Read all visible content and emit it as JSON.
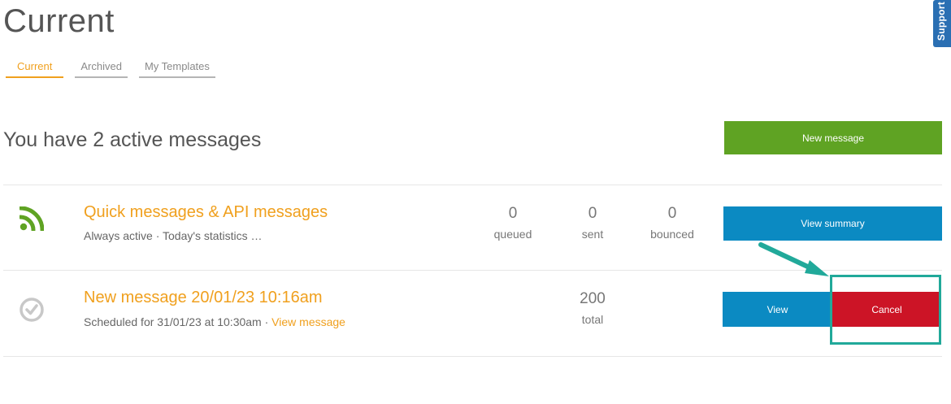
{
  "page": {
    "title": "Current",
    "support_label": "Support"
  },
  "tabs": [
    {
      "label": "Current",
      "active": true
    },
    {
      "label": "Archived",
      "active": false
    },
    {
      "label": "My Templates",
      "active": false
    }
  ],
  "summary": {
    "heading": "You have 2 active messages",
    "new_message_label": "New message"
  },
  "messages": [
    {
      "icon": "rss-feed-icon",
      "title": "Quick messages & API messages",
      "subtitle": "Always active · Today's statistics …",
      "stats": [
        {
          "value": "0",
          "label": "queued"
        },
        {
          "value": "0",
          "label": "sent"
        },
        {
          "value": "0",
          "label": "bounced"
        }
      ],
      "action_label": "View summary"
    },
    {
      "icon": "scheduled-check-icon",
      "title": "New message 20/01/23 10:16am",
      "subtitle": "Scheduled for 31/01/23 at 10:30am · ",
      "subtitle_link": "View message",
      "stats": [
        {
          "value": "200",
          "label": "total"
        }
      ],
      "view_label": "View",
      "cancel_label": "Cancel"
    }
  ],
  "colors": {
    "accent_orange": "#f0a01e",
    "button_green": "#5fa323",
    "button_blue": "#0b8ac2",
    "button_red": "#cc1426",
    "highlight_teal": "#21a99a",
    "support_blue": "#2a6fb3"
  }
}
